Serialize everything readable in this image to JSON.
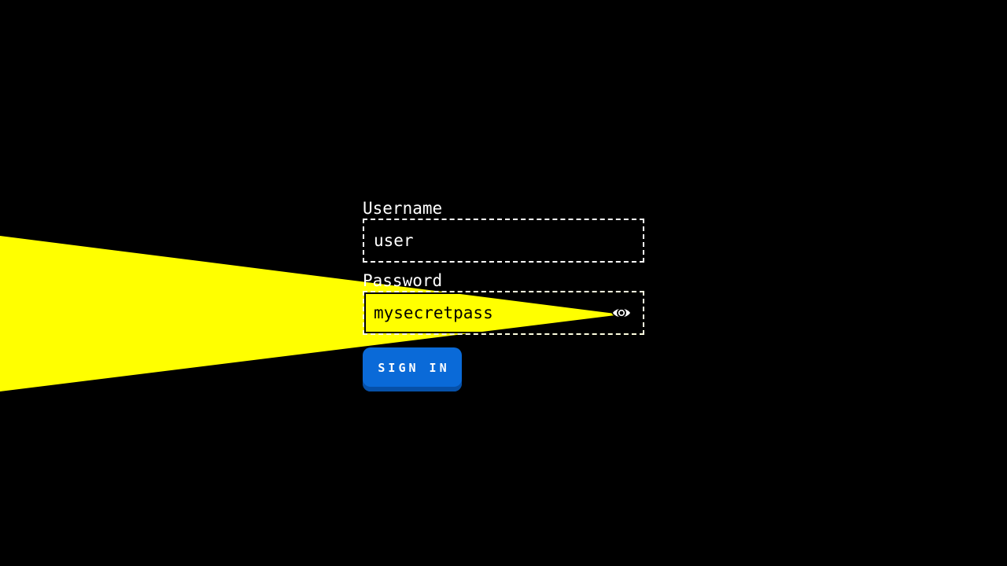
{
  "login": {
    "username_label": "Username",
    "username_value": "user",
    "password_label": "Password",
    "password_value": "mysecretpass",
    "password_toggle_icon": "eye-icon",
    "submit_label": "SIGN IN"
  },
  "colors": {
    "background": "#000000",
    "beam": "#ffff00",
    "button": "#0a6ad8",
    "text": "#ffffff"
  }
}
